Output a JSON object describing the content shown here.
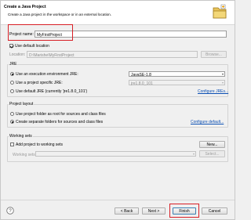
{
  "header": {
    "title": "Create a Java Project",
    "subtitle": "Create a Java project in the workspace or in an external location."
  },
  "project_name": {
    "label": "Project name:",
    "value": "MyFirstProject"
  },
  "location": {
    "use_default_label": "Use default location",
    "use_default_checked": true,
    "label": "Location:",
    "value": "D:\\Marishe\\MyFirstProject",
    "browse_label": "Browse..."
  },
  "jre": {
    "group_label": "JRE",
    "options": [
      {
        "label": "Use an execution environment JRE:",
        "selected": true,
        "value": "JavaSE-1.8"
      },
      {
        "label": "Use a project specific JRE:",
        "selected": false,
        "value": "jre1.8.0_101"
      },
      {
        "label": "Use default JRE (currently 'jre1.8.0_101')",
        "selected": false
      }
    ],
    "configure_link": "Configure JREs..."
  },
  "layout": {
    "group_label": "Project layout",
    "options": [
      {
        "label": "Use project folder as root for sources and class files",
        "selected": false
      },
      {
        "label": "Create separate folders for sources and class files",
        "selected": true
      }
    ],
    "configure_link": "Configure default..."
  },
  "working_sets": {
    "group_label": "Working sets",
    "add_label": "Add project to working sets",
    "add_checked": false,
    "new_label": "New...",
    "sets_label": "Working sets:",
    "select_label": "Select..."
  },
  "footer": {
    "help_icon": "question-mark",
    "back_label": "< Back",
    "next_label": "Next >",
    "finish_label": "Finish",
    "cancel_label": "Cancel"
  },
  "colors": {
    "highlight": "#d81f26",
    "link": "#0b4fb3",
    "banner_bg": "#ffffff"
  }
}
